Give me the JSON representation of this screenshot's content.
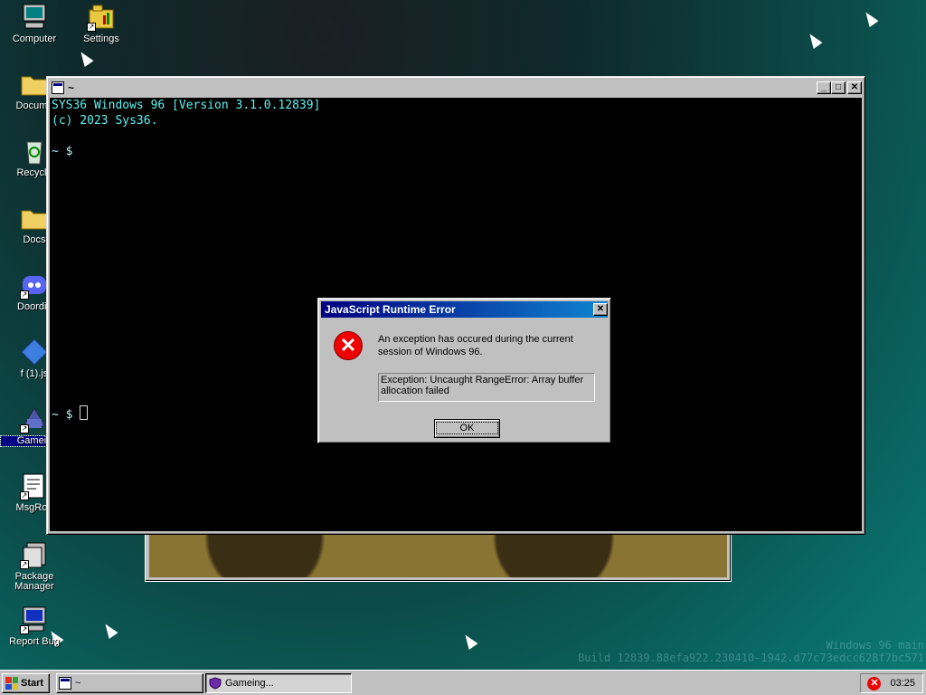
{
  "desktop": {
    "icons": [
      {
        "label": "Computer"
      },
      {
        "label": "Settings"
      },
      {
        "label": "Docume"
      },
      {
        "label": "Recycle"
      },
      {
        "label": "Docs"
      },
      {
        "label": "Doordis"
      },
      {
        "label": "f (1).js"
      },
      {
        "label": "Gamein"
      },
      {
        "label": "MsgRoo"
      },
      {
        "label": "Package Manager"
      },
      {
        "label": "Report Bug"
      }
    ]
  },
  "terminal": {
    "title": "~",
    "lines": {
      "version": "SYS36 Windows 96 [Version 3.1.0.12839]",
      "copyright": "(c) 2023 Sys36.",
      "prompt1": "~ $",
      "prompt2": "~ $ "
    }
  },
  "dialog": {
    "title": "JavaScript Runtime Error",
    "message": "An exception has occured during the current session of Windows 96.",
    "exception": "Exception: Uncaught RangeError: Array buffer allocation failed",
    "ok_label": "OK",
    "close_glyph": "✕"
  },
  "watermark": {
    "line1": "Windows 96 main",
    "line2": "Build 12839.88efa922.230410-1942.d77c73edcc628f7bc571"
  },
  "taskbar": {
    "start_label": "Start",
    "tasks": [
      {
        "label": "~"
      },
      {
        "label": "Gameing..."
      }
    ],
    "clock": "03:25"
  },
  "colors": {
    "title_active": "#000080",
    "error_red": "#e00000",
    "console_text": "#5ff3f3"
  }
}
